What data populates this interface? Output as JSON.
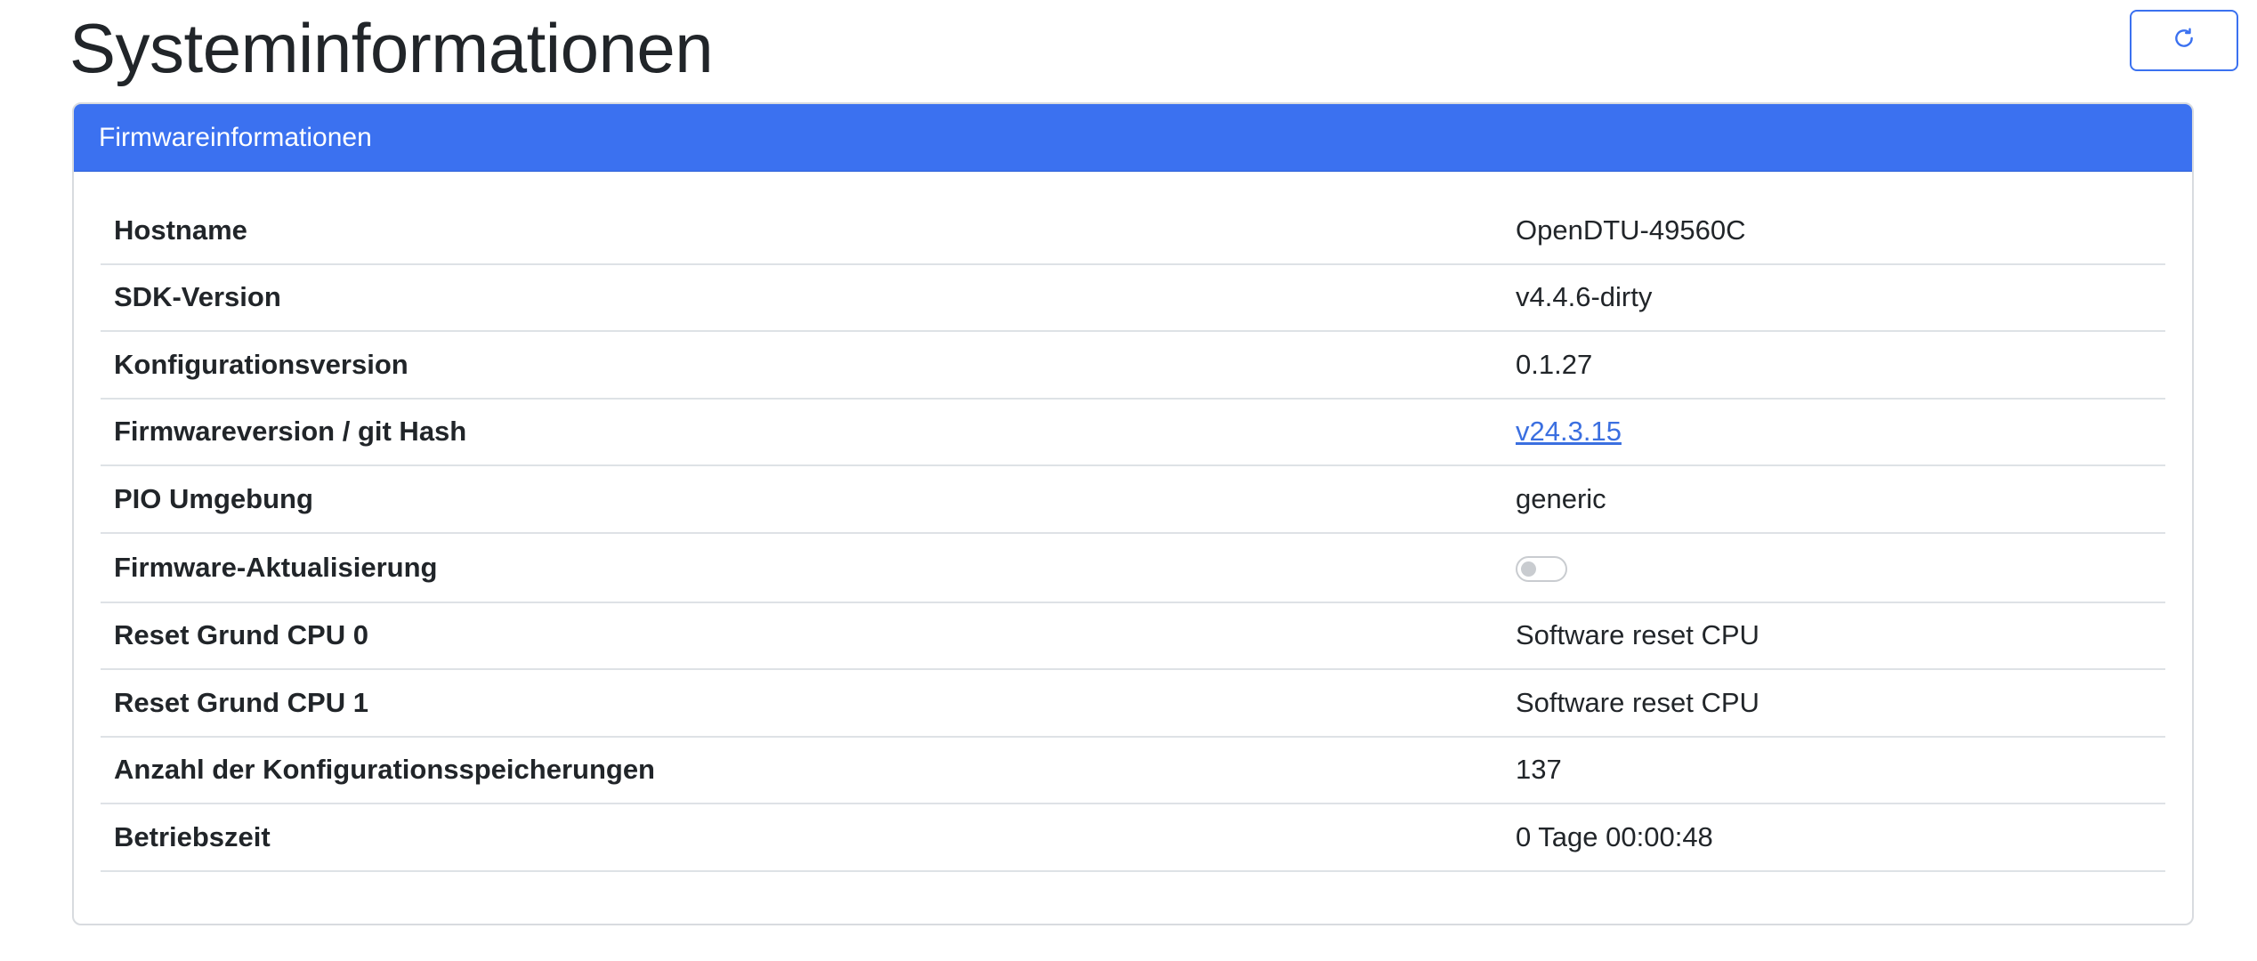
{
  "page": {
    "title": "Systeminformationen"
  },
  "toolbar": {
    "refresh_icon": "refresh-icon",
    "accent_color": "#3b71f0"
  },
  "firmware_card": {
    "header": "Firmwareinformationen",
    "rows": [
      {
        "label": "Hostname",
        "value": "OpenDTU-49560C"
      },
      {
        "label": "SDK-Version",
        "value": "v4.4.6-dirty"
      },
      {
        "label": "Konfigurationsversion",
        "value": "0.1.27"
      },
      {
        "label": "Firmwareversion / git Hash",
        "value": "v24.3.15"
      },
      {
        "label": "PIO Umgebung",
        "value": "generic"
      },
      {
        "label": "Firmware-Aktualisierung",
        "value": "",
        "toggle_state": "off"
      },
      {
        "label": "Reset Grund CPU 0",
        "value": "Software reset CPU"
      },
      {
        "label": "Reset Grund CPU 1",
        "value": "Software reset CPU"
      },
      {
        "label": "Anzahl der Konfigurationsspeicherungen",
        "value": "137"
      },
      {
        "label": "Betriebszeit",
        "value": "0 Tage 00:00:48"
      }
    ]
  }
}
